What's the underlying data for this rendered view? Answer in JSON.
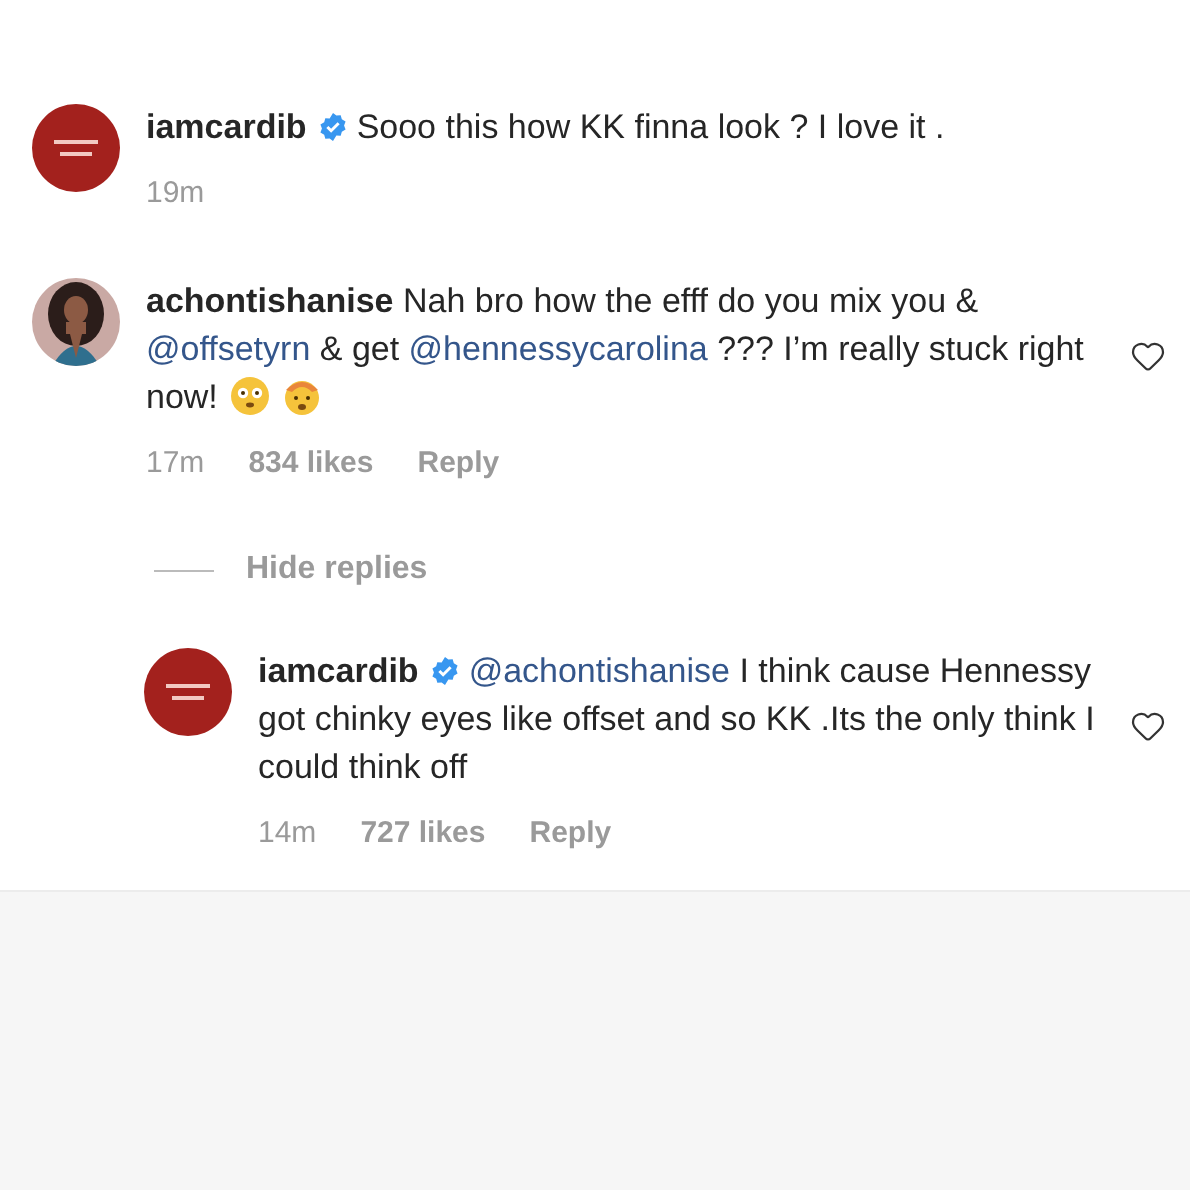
{
  "caption": {
    "username": "iamcardib",
    "verified": true,
    "segments": [
      {
        "kind": "text",
        "text": "Sooo this how KK finna look ? I love it ."
      }
    ],
    "time": "19m"
  },
  "comments": [
    {
      "username": "achontishanise",
      "verified": false,
      "segments": [
        {
          "kind": "text",
          "text": "Nah bro how the efff do you mix you & "
        },
        {
          "kind": "mention",
          "text": "@offsetyrn"
        },
        {
          "kind": "text",
          "text": " & get "
        },
        {
          "kind": "mention",
          "text": "@hennessycarolina"
        },
        {
          "kind": "text",
          "text": " ??? I’m really stuck right now!"
        }
      ],
      "emojis": [
        {
          "kind": "flushed"
        },
        {
          "kind": "exploding"
        }
      ],
      "time": "17m",
      "likes": "834 likes",
      "reply": "Reply",
      "hide_replies": "Hide replies",
      "children": [
        {
          "username": "iamcardib",
          "verified": true,
          "segments": [
            {
              "kind": "mention",
              "text": "@achontishanise"
            },
            {
              "kind": "text",
              "text": " I think cause Hennessy got chinky eyes like offset and so KK .Its the only think I could think off"
            }
          ],
          "time": "14m",
          "likes": "727 likes",
          "reply": "Reply"
        }
      ]
    }
  ]
}
